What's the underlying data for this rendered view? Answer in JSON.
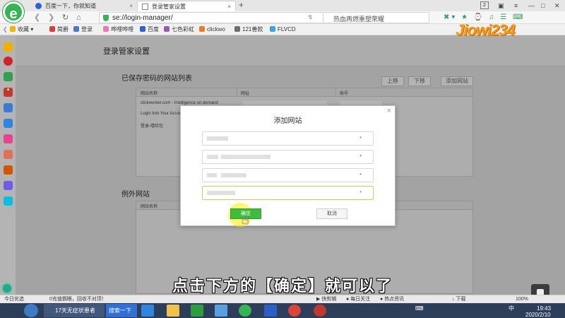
{
  "browser": {
    "logo_letter": "e",
    "tabs": [
      {
        "title": "百度一下，你就知道",
        "active": false
      },
      {
        "title": "登录管家设置",
        "active": true
      }
    ],
    "new_tab": "+",
    "window_badge": "2",
    "url": "se://login-manager/",
    "search_text": "热血再燃重塑荣耀",
    "bookmarks": [
      "收藏",
      "简爵",
      "登录",
      "哗哩哗哩",
      "百度",
      "七色彩虹",
      "clickwo",
      "121善款",
      "FLVCD"
    ]
  },
  "page": {
    "title": "登录管家设置",
    "saved_section": {
      "title": "已保存密码的网站列表",
      "buttons": {
        "up": "上移",
        "down": "下移",
        "add": "添加网站"
      },
      "columns": [
        "网站名称",
        "网址",
        "账号"
      ],
      "rows": [
        {
          "site": "clickworker.com - Intelligence on demand"
        },
        {
          "site": "Login Into Your Account"
        },
        {
          "site": "登录-嘻哈包"
        }
      ]
    },
    "exception_section": {
      "title": "例外网站",
      "columns": [
        "网站名称"
      ]
    }
  },
  "modal": {
    "title": "添加网站",
    "close": "×",
    "fields": [
      {
        "active": false
      },
      {
        "active": false
      },
      {
        "active": false
      },
      {
        "active": true
      }
    ],
    "ok_label": "确定",
    "cancel_label": "取消"
  },
  "overlay": {
    "subtitle": "点击下方的【确定】就可以了",
    "watermark": "Jiowi234"
  },
  "statusbar": {
    "left": "今日优选",
    "clean": "0充值鹦眼，回收不对顶！",
    "items": [
      "快剪辑",
      "每日关注",
      "热点资讯",
      "下载"
    ],
    "zoom": "100%"
  },
  "taskbar": {
    "window": "17天无症状患者",
    "search": "搜索一下",
    "lang": "中",
    "time": "19:43",
    "date": "2020/2/10"
  },
  "colors": {
    "accent_green": "#3ebc3e",
    "brand_green": "#35b454",
    "watermark_orange": "#f39a1e",
    "taskbar": "#2c3e5a"
  }
}
